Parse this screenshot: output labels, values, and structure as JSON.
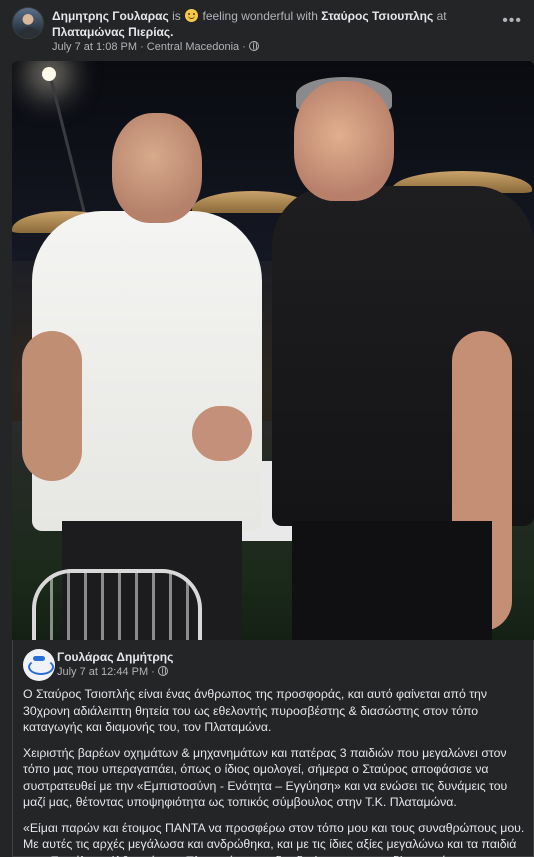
{
  "post": {
    "author": "Δημητρης Γουλαρας",
    "is_word": "is",
    "feeling_text": "feeling wonderful with",
    "tagged": "Σταύρος Τσιουπλης",
    "at_word": "at",
    "location": "Πλαταμώνας Πιερίας",
    "time": "July 7 at 1:08 PM",
    "place": "Central Macedonia",
    "more_icon": "more-horizontal-icon"
  },
  "shared": {
    "author": "Γουλάρας Δημήτρης",
    "time": "July 7 at 12:44 PM",
    "paragraphs": [
      "Ο Σταύρος Τσιοπλής είναι ένας άνθρωπος της προσφοράς, και αυτό φαίνεται  από την 30χρονη αδιάλειπτη θητεία του ως εθελοντής πυροσβέστης & διασώστης στον τόπο καταγωγής και διαμονής του, τον Πλαταμώνα.",
      "Χειριστής βαρέων οχημάτων & μηχανημάτων και πατέρας 3  παιδιών που μεγαλώνει στον τόπο  μας που υπεραγαπάει, όπως ο ίδιος ομολογεί,  σήμερα ο Σταύρος αποφάσισε να συστρατευθεί  με την «Εμπιστοσύνη - Ενότητα – Εγγύηση» και να ενώσει τις δυνάμεις του μαζί μας, θέτοντας υποψηφιότητα ως τοπικός σύμβουλος στην Τ.Κ. Πλαταμώνα.",
      "«Είμαι παρών και έτοιμος ΠΑΝΤΑ να προσφέρω στον τόπο μου και τους συναθρώπους μου. Με αυτές τις αρχές  μεγάλωσα και ανδρώθηκα, και με τις ίδιες αξίες μεγαλώνω και τα παιδιά μου. Επιτέλους ήλθε η ώρα ο Πλαταμώνας να διεκδικήσει και να κερδίσει αυτό που"
    ]
  }
}
